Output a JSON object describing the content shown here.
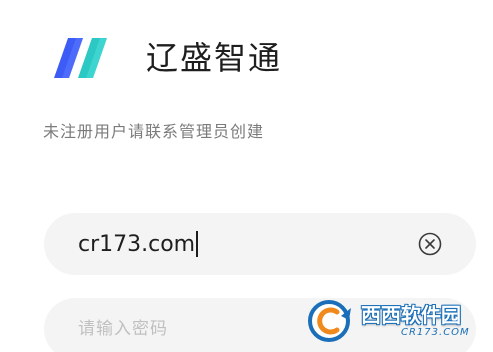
{
  "app": {
    "name": "辽盛智通",
    "logo_icon": "double-slash-logo-icon",
    "logo_colors": {
      "blue": "#3d5cf5",
      "teal": "#2cc8c4"
    }
  },
  "notice": "未注册用户请联系管理员创建",
  "form": {
    "username": {
      "value": "cr173.com",
      "clear_icon": "clear-circle-x-icon"
    },
    "password": {
      "placeholder": "请输入密码"
    }
  },
  "watermark": {
    "main": "西西软件园",
    "sub": "CR173.COM",
    "colors": {
      "blue": "#1a6fb8",
      "orange": "#f08a1c"
    }
  }
}
